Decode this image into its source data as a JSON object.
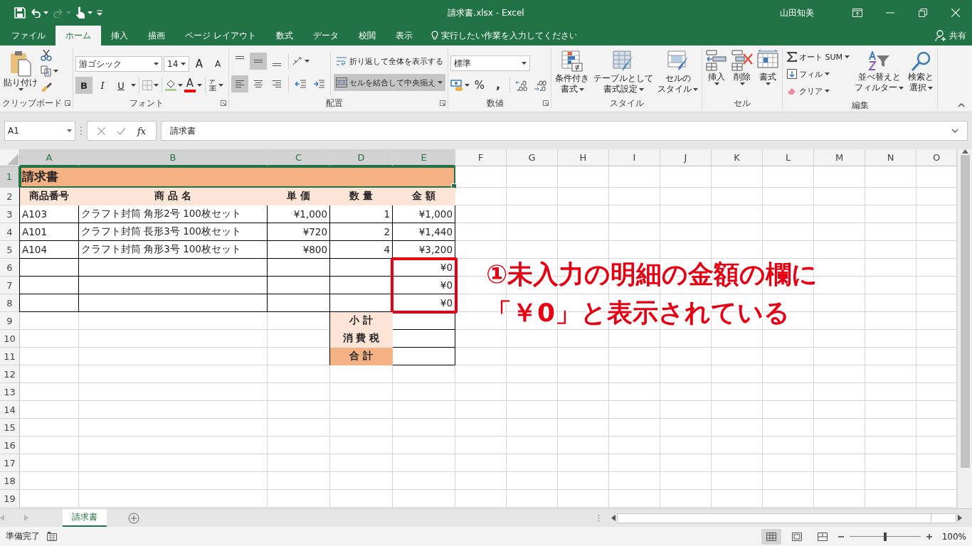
{
  "window": {
    "title": "請求書.xlsx  -  Excel",
    "user": "山田知美"
  },
  "tabs": [
    {
      "label": "ファイル",
      "selected": false
    },
    {
      "label": "ホーム",
      "selected": true
    },
    {
      "label": "挿入",
      "selected": false
    },
    {
      "label": "描画",
      "selected": false
    },
    {
      "label": "ページ レイアウト",
      "selected": false
    },
    {
      "label": "数式",
      "selected": false
    },
    {
      "label": "データ",
      "selected": false
    },
    {
      "label": "校閲",
      "selected": false
    },
    {
      "label": "表示",
      "selected": false
    }
  ],
  "tell_me": {
    "placeholder": "実行したい作業を入力してください"
  },
  "share": "共有",
  "ribbon": {
    "clipboard": {
      "label": "クリップボード",
      "paste": "貼り付け"
    },
    "font": {
      "label": "フォント",
      "font_name": "游ゴシック",
      "font_size": "14",
      "grow": "A",
      "shrink": "A",
      "styles": [
        {
          "kind": "bold",
          "label": "B",
          "on": true
        },
        {
          "kind": "italic",
          "label": "I",
          "on": false
        },
        {
          "kind": "underline",
          "label": "U",
          "on": false
        }
      ],
      "font_color": "A"
    },
    "alignment": {
      "label": "配置",
      "vertical": [
        {
          "kind": "top",
          "on": false
        },
        {
          "kind": "middle",
          "on": true
        },
        {
          "kind": "bottom",
          "on": false
        }
      ],
      "horizontal": [
        {
          "kind": "left",
          "on": true
        },
        {
          "kind": "center",
          "on": false
        },
        {
          "kind": "right",
          "on": false
        }
      ],
      "wrap": {
        "label": "折り返して全体を表示する",
        "on": false
      },
      "merge": {
        "label": "セルを結合して中央揃え",
        "on": true
      }
    },
    "number": {
      "label": "数値",
      "format": "標準",
      "percent": "%",
      "comma": ","
    },
    "styles": {
      "label": "スタイル",
      "buttons": [
        {
          "kind": "conditional",
          "lines": [
            "条件付き",
            "書式"
          ]
        },
        {
          "kind": "table",
          "lines": [
            "テーブルとして",
            "書式設定"
          ]
        },
        {
          "kind": "cell",
          "lines": [
            "セルの",
            "スタイル"
          ]
        }
      ]
    },
    "cells": {
      "label": "セル",
      "buttons": [
        {
          "kind": "insert",
          "label": "挿入"
        },
        {
          "kind": "delete",
          "label": "削除"
        },
        {
          "kind": "format",
          "label": "書式"
        }
      ]
    },
    "editing": {
      "label": "編集",
      "autosum": "オート SUM",
      "fill": "フィル",
      "clear": "クリア",
      "sort": [
        "並べ替えと",
        "フィルター"
      ],
      "find": [
        "検索と",
        "選択"
      ]
    }
  },
  "formula_bar": {
    "name_box": "A1",
    "fx": "fx",
    "formula": "請求書"
  },
  "sheet": {
    "columns": [
      {
        "label": "A",
        "selected": true
      },
      {
        "label": "B",
        "selected": true
      },
      {
        "label": "C",
        "selected": true
      },
      {
        "label": "D",
        "selected": true
      },
      {
        "label": "E",
        "selected": true
      },
      {
        "label": "F",
        "selected": false
      },
      {
        "label": "G",
        "selected": false
      },
      {
        "label": "H",
        "selected": false
      },
      {
        "label": "I",
        "selected": false
      },
      {
        "label": "J",
        "selected": false
      },
      {
        "label": "K",
        "selected": false
      },
      {
        "label": "L",
        "selected": false
      },
      {
        "label": "M",
        "selected": false
      },
      {
        "label": "N",
        "selected": false
      },
      {
        "label": "O",
        "selected": false
      }
    ],
    "rows": [
      {
        "number": "1",
        "selected": true,
        "cells": [
          {
            "kind": "title",
            "text": "請求書",
            "selected": true
          }
        ]
      },
      {
        "number": "2",
        "selected": false,
        "cells": [
          {
            "kind": "header",
            "text": "商品番号"
          },
          {
            "kind": "header",
            "text": "商 品 名"
          },
          {
            "kind": "header",
            "text": "単 価"
          },
          {
            "kind": "header",
            "text": "数 量"
          },
          {
            "kind": "header",
            "text": "金 額"
          }
        ]
      },
      {
        "number": "3",
        "selected": false,
        "cells": [
          {
            "kind": "text",
            "text": "A103"
          },
          {
            "kind": "text",
            "text": "クラフト封筒 角形2号 100枚セット"
          },
          {
            "kind": "number",
            "text": "¥1,000"
          },
          {
            "kind": "number",
            "text": "1"
          },
          {
            "kind": "number",
            "text": "¥1,000"
          }
        ]
      },
      {
        "number": "4",
        "selected": false,
        "cells": [
          {
            "kind": "text",
            "text": "A101"
          },
          {
            "kind": "text",
            "text": "クラフト封筒 長形3号 100枚セット"
          },
          {
            "kind": "number",
            "text": "¥720"
          },
          {
            "kind": "number",
            "text": "2"
          },
          {
            "kind": "number",
            "text": "¥1,440"
          }
        ]
      },
      {
        "number": "5",
        "selected": false,
        "cells": [
          {
            "kind": "text",
            "text": "A104"
          },
          {
            "kind": "text",
            "text": "クラフト封筒 角形3号 100枚セット"
          },
          {
            "kind": "number",
            "text": "¥800"
          },
          {
            "kind": "number",
            "text": "4"
          },
          {
            "kind": "number",
            "text": "¥3,200"
          }
        ]
      },
      {
        "number": "6",
        "selected": false,
        "cells": [
          {
            "kind": "blank"
          },
          {
            "kind": "blank"
          },
          {
            "kind": "blank"
          },
          {
            "kind": "blank"
          },
          {
            "kind": "number",
            "text": "¥0"
          }
        ]
      },
      {
        "number": "7",
        "selected": false,
        "cells": [
          {
            "kind": "blank"
          },
          {
            "kind": "blank"
          },
          {
            "kind": "blank"
          },
          {
            "kind": "blank"
          },
          {
            "kind": "number",
            "text": "¥0"
          }
        ]
      },
      {
        "number": "8",
        "selected": false,
        "cells": [
          {
            "kind": "blank"
          },
          {
            "kind": "blank"
          },
          {
            "kind": "blank"
          },
          {
            "kind": "blank"
          },
          {
            "kind": "number",
            "text": "¥0"
          }
        ]
      },
      {
        "number": "9",
        "selected": false,
        "cells": [
          {
            "kind": "empty"
          },
          {
            "kind": "empty"
          },
          {
            "kind": "empty"
          },
          {
            "kind": "label",
            "text": "小 計"
          },
          {
            "kind": "blank"
          }
        ]
      },
      {
        "number": "10",
        "selected": false,
        "cells": [
          {
            "kind": "empty"
          },
          {
            "kind": "empty"
          },
          {
            "kind": "empty"
          },
          {
            "kind": "label",
            "text": "消 費 税"
          },
          {
            "kind": "blank"
          }
        ]
      },
      {
        "number": "11",
        "selected": false,
        "cells": [
          {
            "kind": "empty"
          },
          {
            "kind": "empty"
          },
          {
            "kind": "empty"
          },
          {
            "kind": "total-label",
            "text": "合 計"
          },
          {
            "kind": "blank"
          }
        ]
      },
      {
        "number": "12",
        "selected": false,
        "cells": []
      },
      {
        "number": "13",
        "selected": false,
        "cells": []
      },
      {
        "number": "14",
        "selected": false,
        "cells": []
      },
      {
        "number": "15",
        "selected": false,
        "cells": []
      },
      {
        "number": "16",
        "selected": false,
        "cells": []
      },
      {
        "number": "17",
        "selected": false,
        "cells": []
      },
      {
        "number": "18",
        "selected": false,
        "cells": []
      },
      {
        "number": "19",
        "selected": false,
        "cells": []
      }
    ]
  },
  "annotation": {
    "lines": [
      "①未入力の明細の金額の欄に",
      "「￥0」と表示されている"
    ]
  },
  "sheet_tabs": [
    {
      "label": "請求書",
      "selected": true
    }
  ],
  "status_bar": {
    "status": "準備完了",
    "zoom": "100%",
    "zoom_slider": {
      "level": 0.5
    }
  }
}
